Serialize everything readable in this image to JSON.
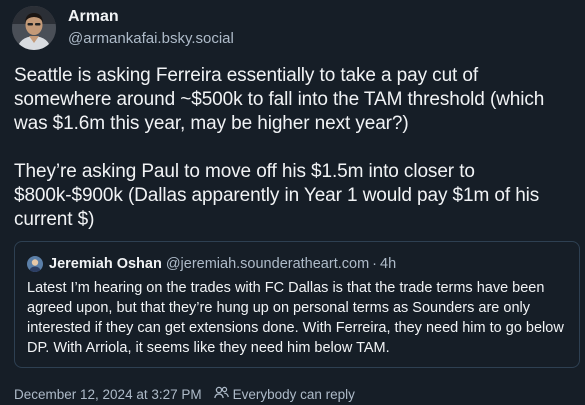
{
  "post": {
    "author": {
      "display_name": "Arman",
      "handle": "@armankafai.bsky.social",
      "avatar_icon": "profile-photo"
    },
    "text": "Seattle is asking Ferreira essentially to take a pay cut of somewhere around ~$500k to fall into the TAM threshold (which was $1.6m this year, may be higher next year?)\n\nThey’re asking Paul to move off his $1.5m into closer to $800k-$900k (Dallas apparently in Year 1 would pay $1m of his current $)",
    "quote": {
      "display_name": "Jeremiah Oshan",
      "handle": "@jeremiah.sounderatheart.com",
      "separator": "·",
      "age": "4h",
      "text": "Latest I’m hearing on the trades with FC Dallas is that the trade terms have been agreed upon, but that they’re hung up on personal terms as Sounders are only interested if they can get extensions done. With Ferreira, they need him to go below DP. With Arriola, it seems like they need him below TAM."
    },
    "footer": {
      "timestamp": "December 12, 2024 at 3:27 PM",
      "reply_permission": "Everybody can reply",
      "icon": "people-icon"
    }
  },
  "colors": {
    "background": "#161e27",
    "text": "#f1f3f5",
    "secondary_text": "#aebbc9",
    "quote_border": "#2e4052"
  }
}
